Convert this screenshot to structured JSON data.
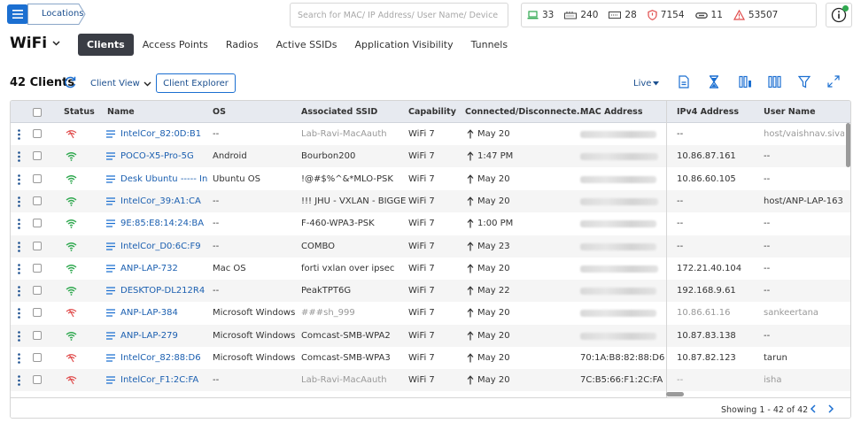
{
  "header": {
    "breadcrumb": "Locations",
    "search_placeholder": "Search for MAC/ IP Address/ User Name/ Device Name...",
    "stats": [
      {
        "icon": "laptop-icon",
        "value": "33"
      },
      {
        "icon": "switch-icon",
        "value": "240"
      },
      {
        "icon": "gateway-icon",
        "value": "28"
      },
      {
        "icon": "shield-icon",
        "value": "7154"
      },
      {
        "icon": "link-icon",
        "value": "11"
      },
      {
        "icon": "alert-triangle-icon",
        "value": "53507"
      }
    ]
  },
  "page": {
    "title": "WiFi",
    "tabs": [
      "Clients",
      "Access Points",
      "Radios",
      "Active SSIDs",
      "Application Visibility",
      "Tunnels"
    ],
    "active_tab": "Clients"
  },
  "toolbar": {
    "count": "42 Clients",
    "view": "Client View",
    "explorer": "Client Explorer",
    "live": "Live"
  },
  "table": {
    "columns": [
      "Status",
      "Name",
      "OS",
      "Associated SSID",
      "Capability",
      "Connected/Disconnecte...",
      "MAC Address",
      "IPv4 Address",
      "User Name"
    ],
    "rows": [
      {
        "status": "disconnected",
        "name": "IntelCor_82:0D:B1",
        "os": "--",
        "ssid": "Lab-Ravi-MacAauth",
        "ssid_muted": true,
        "cap": "WiFi 7",
        "conn": "May 20",
        "mac": "",
        "ip": "--",
        "ip_muted": false,
        "user": "host/vaishnav.sivap",
        "user_muted": true
      },
      {
        "status": "connected",
        "name": "POCO-X5-Pro-5G",
        "os": "Android",
        "ssid": "Bourbon200",
        "ssid_muted": false,
        "cap": "WiFi 7",
        "conn": "1:47 PM",
        "mac": "",
        "ip": "10.86.87.161",
        "ip_muted": false,
        "user": "--",
        "user_muted": false
      },
      {
        "status": "connected",
        "name": "Desk Ubuntu ----- In",
        "os": "Ubuntu OS",
        "ssid": "!@#$%^&*MLO-PSK",
        "ssid_muted": false,
        "cap": "WiFi 7",
        "conn": "May 20",
        "mac": "",
        "ip": "10.86.60.105",
        "ip_muted": false,
        "user": "--",
        "user_muted": false
      },
      {
        "status": "connected",
        "name": "IntelCor_39:A1:CA",
        "os": "--",
        "ssid": "!!! JHU - VXLAN - BIGGER",
        "ssid_muted": false,
        "cap": "WiFi 7",
        "conn": "May 20",
        "mac": "",
        "ip": "--",
        "ip_muted": false,
        "user": "host/ANP-LAP-163.t",
        "user_muted": false
      },
      {
        "status": "connected",
        "name": "9E:85:E8:14:24:BA",
        "os": "--",
        "ssid": "F-460-WPA3-PSK",
        "ssid_muted": false,
        "cap": "WiFi 7",
        "conn": "1:00 PM",
        "mac": "",
        "ip": "--",
        "ip_muted": false,
        "user": "--",
        "user_muted": false
      },
      {
        "status": "connected",
        "name": "IntelCor_D0:6C:F9",
        "os": "--",
        "ssid": "COMBO",
        "ssid_muted": false,
        "cap": "WiFi 7",
        "conn": "May 23",
        "mac": "",
        "ip": "--",
        "ip_muted": false,
        "user": "--",
        "user_muted": false
      },
      {
        "status": "connected",
        "name": "ANP-LAP-732",
        "os": "Mac OS",
        "ssid": "forti vxlan over ipsec",
        "ssid_muted": false,
        "cap": "WiFi 7",
        "conn": "May 20",
        "mac": "",
        "ip": "172.21.40.104",
        "ip_muted": false,
        "user": "--",
        "user_muted": false
      },
      {
        "status": "connected",
        "name": "DESKTOP-DL212R4",
        "os": "--",
        "ssid": "PeakTPT6G",
        "ssid_muted": false,
        "cap": "WiFi 7",
        "conn": "May 22",
        "mac": "",
        "ip": "192.168.9.61",
        "ip_muted": false,
        "user": "--",
        "user_muted": false
      },
      {
        "status": "disconnected",
        "name": "ANP-LAP-384",
        "os": "Microsoft Windows",
        "ssid": "###sh_999",
        "ssid_muted": true,
        "cap": "WiFi 7",
        "conn": "May 20",
        "mac": "",
        "ip": "10.86.61.16",
        "ip_muted": true,
        "user": "sankeertana",
        "user_muted": true
      },
      {
        "status": "connected",
        "name": "ANP-LAP-279",
        "os": "Microsoft Windows",
        "ssid": "Comcast-SMB-WPA2",
        "ssid_muted": false,
        "cap": "WiFi 7",
        "conn": "May 20",
        "mac": "",
        "ip": "10.87.83.138",
        "ip_muted": false,
        "user": "--",
        "user_muted": false
      },
      {
        "status": "disconnected",
        "name": "IntelCor_82:88:D6",
        "os": "Microsoft Windows",
        "ssid": "Comcast-SMB-WPA3",
        "ssid_muted": false,
        "cap": "WiFi 7",
        "conn": "May 20",
        "mac": "70:1A:B8:82:88:D6",
        "ip": "10.87.82.123",
        "ip_muted": false,
        "user": "tarun",
        "user_muted": false
      },
      {
        "status": "disconnected",
        "name": "IntelCor_F1:2C:FA",
        "os": "--",
        "ssid": "Lab-Ravi-MacAauth",
        "ssid_muted": true,
        "cap": "WiFi 7",
        "conn": "May 20",
        "mac": "7C:B5:66:F1:2C:FA",
        "ip": "--",
        "ip_muted": true,
        "user": "isha",
        "user_muted": true
      }
    ]
  },
  "footer": {
    "showing": "Showing 1 - 42 of 42"
  },
  "colors": {
    "accent": "#1b6fd1",
    "connected": "#2fa84f",
    "disconnected": "#e04a4a",
    "tab_active_bg": "#3a3d45"
  }
}
